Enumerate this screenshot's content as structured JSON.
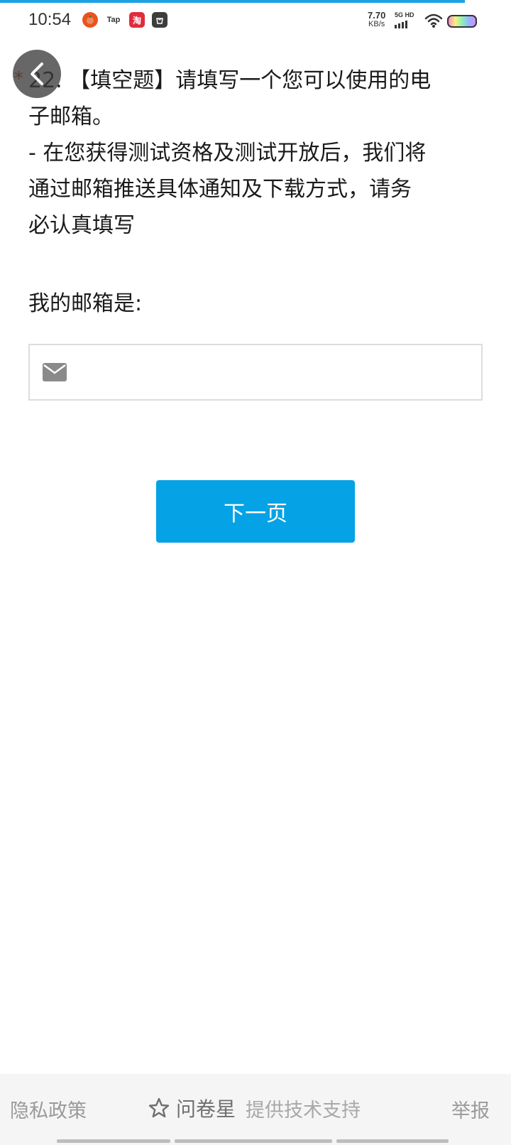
{
  "status_bar": {
    "time": "10:54",
    "tap_label": "Tap",
    "taobao_label": "淘",
    "net_speed_value": "7.70",
    "net_speed_unit": "KB/s",
    "signal_label": "5G HD"
  },
  "question": {
    "required_mark": "*",
    "line1": "22. 【填空题】请填写一个您可以使用的电",
    "line2": "子邮箱。",
    "line3": "- 在您获得测试资格及测试开放后，我们将",
    "line4": "通过邮箱推送具体通知及下载方式，请务",
    "line5": "必认真填写",
    "email_label": "我的邮箱是:"
  },
  "email_input": {
    "value": "",
    "placeholder": ""
  },
  "next_button": {
    "label": "下一页"
  },
  "footer": {
    "privacy": "隐私政策",
    "brand": "问卷星",
    "support": "提供技术支持",
    "report": "举报"
  },
  "colors": {
    "accent": "#05a2e6",
    "required": "#c0392b",
    "footer_bg": "#f5f5f5"
  }
}
